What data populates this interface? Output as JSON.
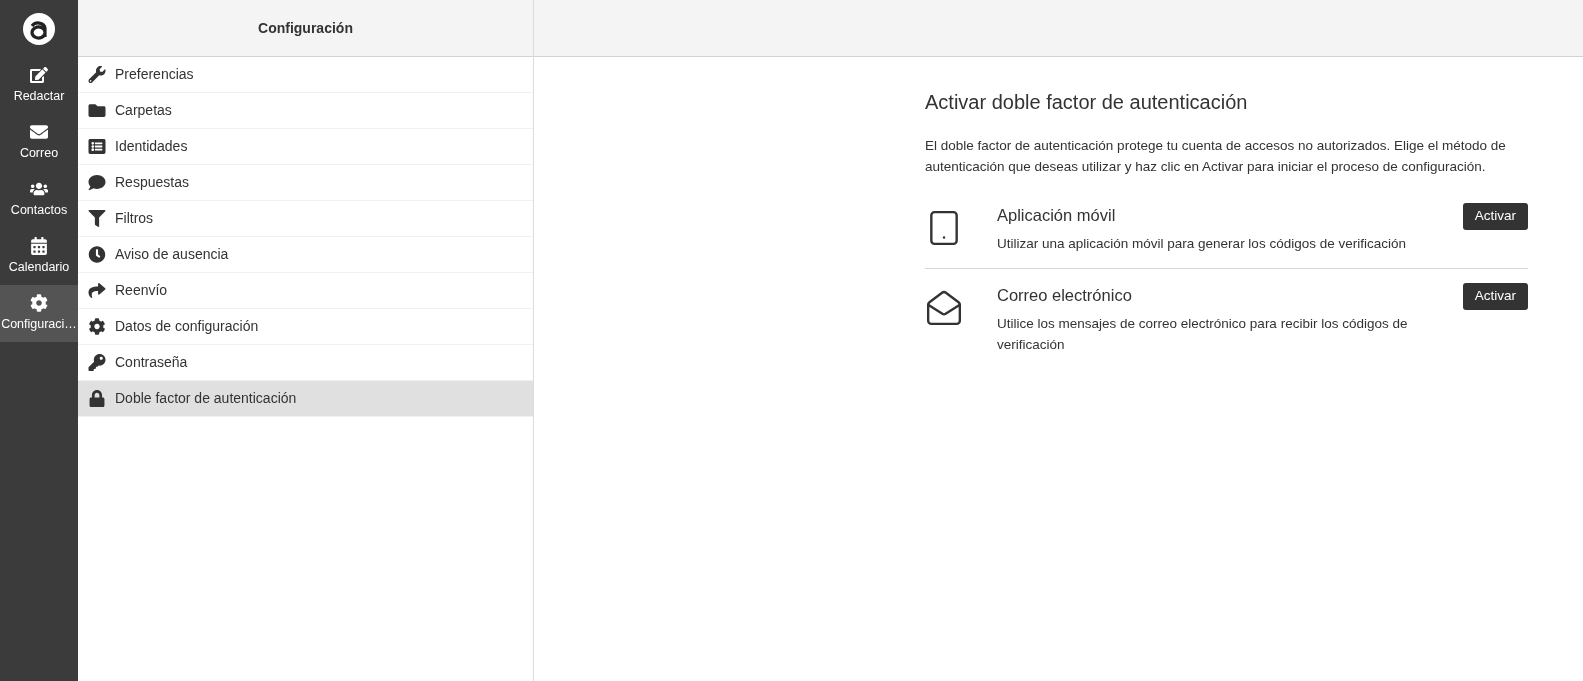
{
  "nav": [
    {
      "label": "Redactar",
      "selected": false
    },
    {
      "label": "Correo",
      "selected": false
    },
    {
      "label": "Contactos",
      "selected": false
    },
    {
      "label": "Calendario",
      "selected": false
    },
    {
      "label": "Configuraci…",
      "selected": true
    }
  ],
  "settings": {
    "title": "Configuración",
    "items": [
      {
        "label": "Preferencias",
        "selected": false
      },
      {
        "label": "Carpetas",
        "selected": false
      },
      {
        "label": "Identidades",
        "selected": false
      },
      {
        "label": "Respuestas",
        "selected": false
      },
      {
        "label": "Filtros",
        "selected": false
      },
      {
        "label": "Aviso de ausencia",
        "selected": false
      },
      {
        "label": "Reenvío",
        "selected": false
      },
      {
        "label": "Datos de configuración",
        "selected": false
      },
      {
        "label": "Contraseña",
        "selected": false
      },
      {
        "label": "Doble factor de autenticación",
        "selected": true
      }
    ]
  },
  "content": {
    "title": "Activar doble factor de autenticación",
    "description": "El doble factor de autenticación protege tu cuenta de accesos no autorizados. Elige el método de autenticación que deseas utilizar y haz clic en Activar para iniciar el proceso de configuración.",
    "methods": [
      {
        "kind": "app",
        "title": "Aplicación móvil",
        "description": "Utilizar una aplicación móvil para generar los códigos de verificación",
        "button": "Activar"
      },
      {
        "kind": "email",
        "title": "Correo electrónico",
        "description": "Utilice los mensajes de correo electrónico para recibir los códigos de verificación",
        "button": "Activar"
      }
    ]
  }
}
